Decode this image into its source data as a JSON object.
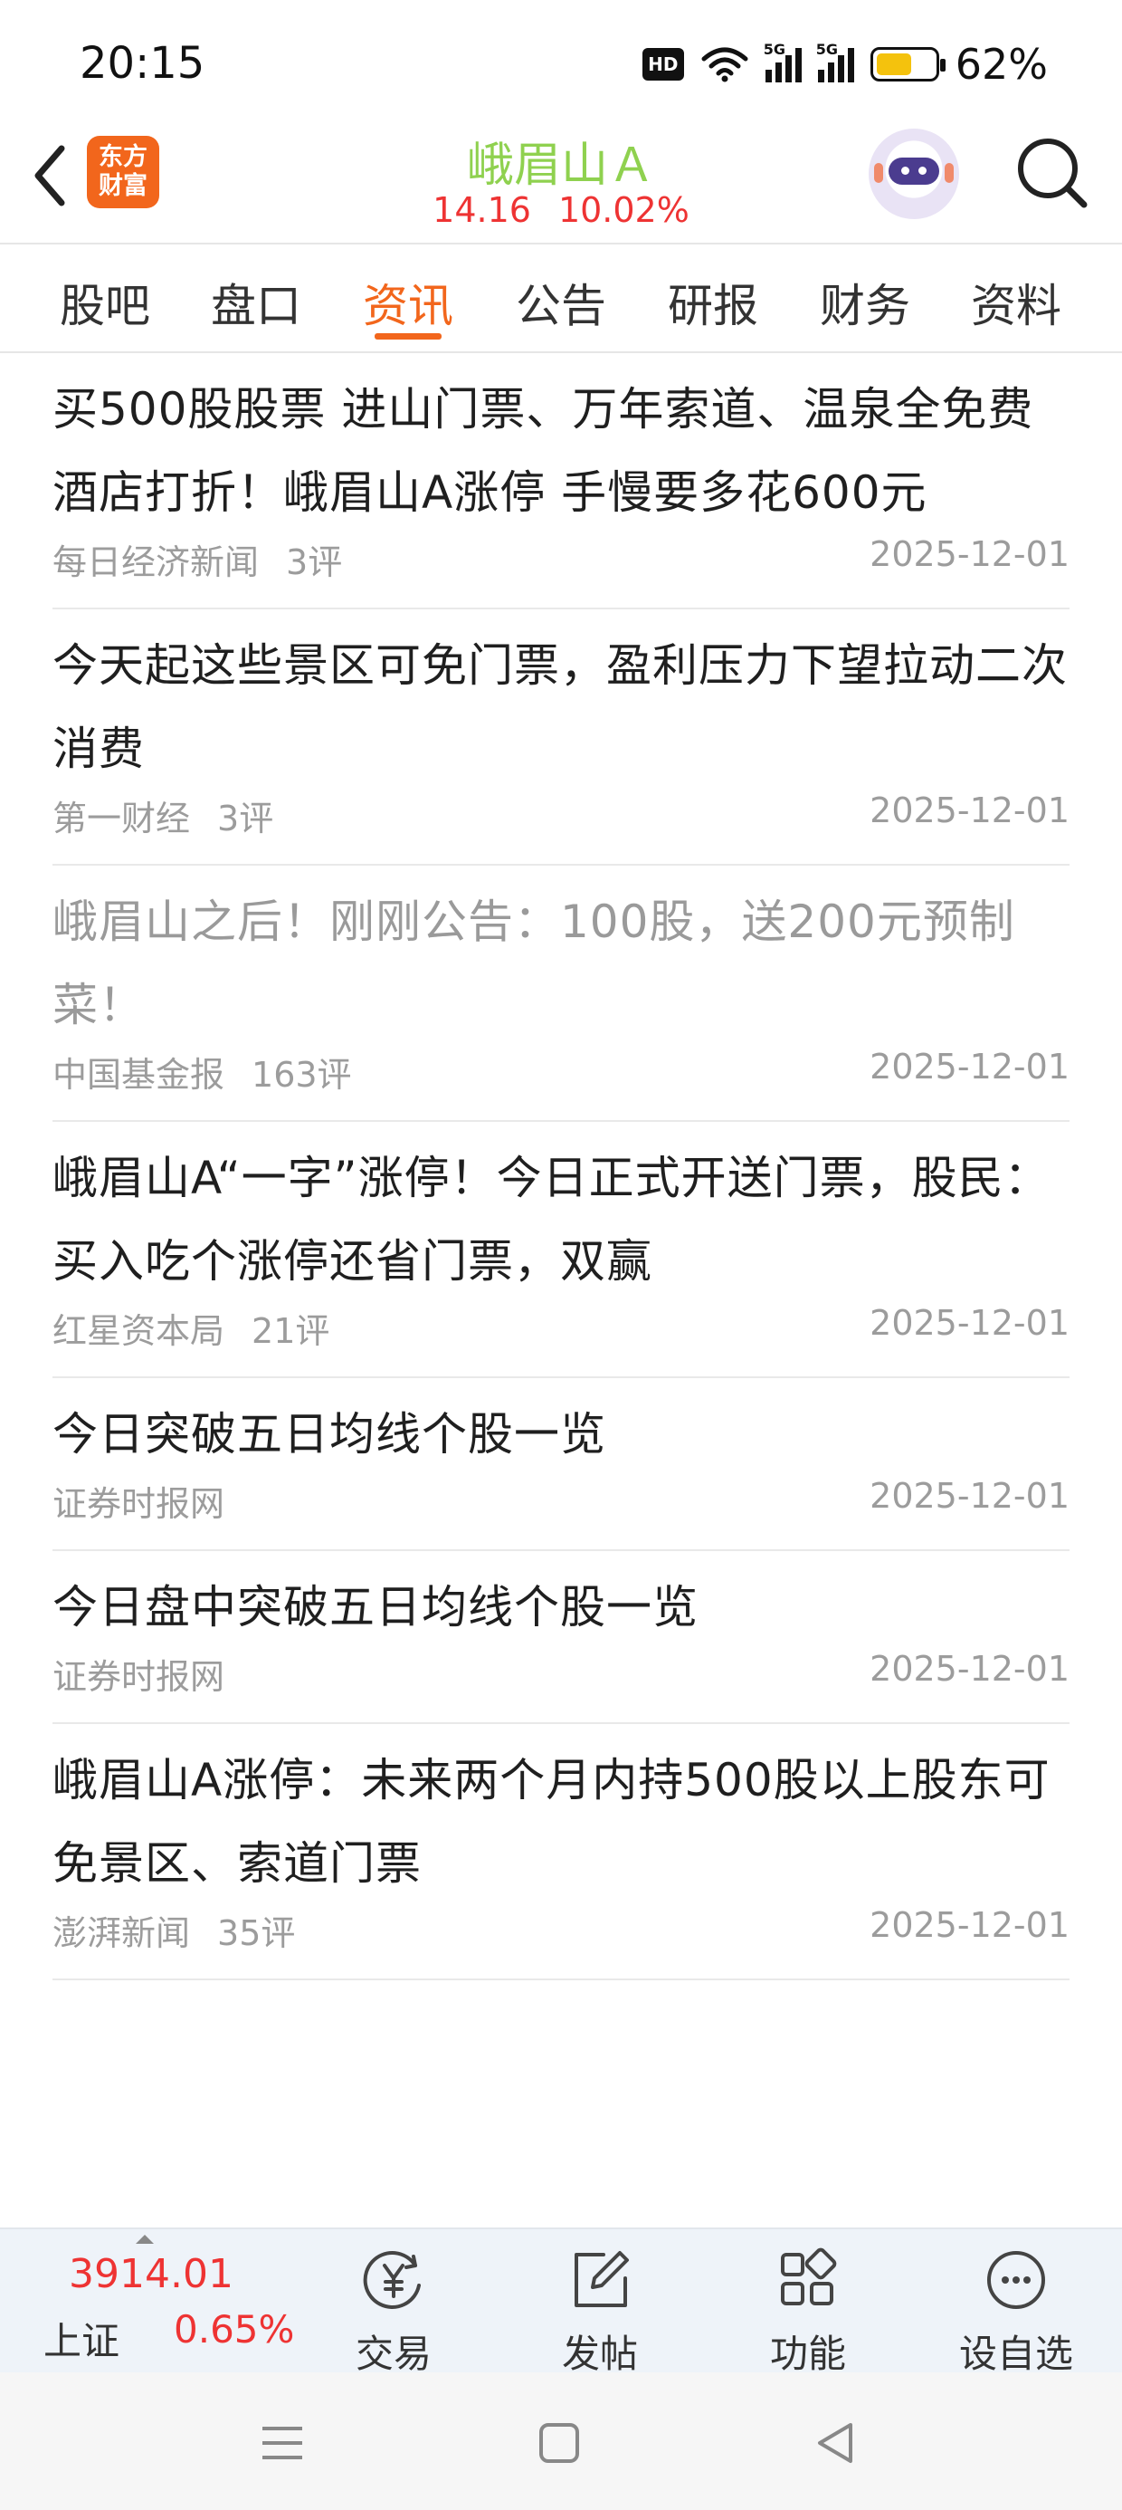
{
  "status_bar": {
    "time": "20:15",
    "hd_label": "HD",
    "network_label_1": "5G",
    "network_label_2": "5G",
    "battery_percent": "62%",
    "battery_level": 0.62
  },
  "header": {
    "app_logo_line1": "东方",
    "app_logo_line2": "财富",
    "stock_name": "峨眉山Ａ",
    "price": "14.16",
    "change_percent": "10.02%"
  },
  "tabs": [
    "股吧",
    "盘口",
    "资讯",
    "公告",
    "研报",
    "财务",
    "资料"
  ],
  "active_tab": "资讯",
  "news": [
    {
      "title": "买500股股票 进山门票、万年索道、温泉全免费 酒店打折！峨眉山A涨停 手慢要多花600元",
      "source": "每日经济新闻",
      "comments": "3评",
      "date": "2025-12-01",
      "read": false
    },
    {
      "title": "今天起这些景区可免门票，盈利压力下望拉动二次消费",
      "source": "第一财经",
      "comments": "3评",
      "date": "2025-12-01",
      "read": false
    },
    {
      "title": "峨眉山之后！刚刚公告：100股，送200元预制菜！",
      "source": "中国基金报",
      "comments": "163评",
      "date": "2025-12-01",
      "read": true
    },
    {
      "title": "峨眉山A“一字”涨停！今日正式开送门票，股民：买入吃个涨停还省门票，双赢",
      "source": "红星资本局",
      "comments": "21评",
      "date": "2025-12-01",
      "read": false
    },
    {
      "title": "今日突破五日均线个股一览",
      "source": "证券时报网",
      "comments": "",
      "date": "2025-12-01",
      "read": false
    },
    {
      "title": "今日盘中突破五日均线个股一览",
      "source": "证券时报网",
      "comments": "",
      "date": "2025-12-01",
      "read": false
    },
    {
      "title": "峨眉山A涨停：未来两个月内持500股以上股东可免景区、索道门票",
      "source": "澎湃新闻",
      "comments": "35评",
      "date": "2025-12-01",
      "read": false
    }
  ],
  "bottom_bar": {
    "index_value": "3914.01",
    "index_name": "上证",
    "index_change": "0.65%",
    "trade_label": "交易",
    "post_label": "发帖",
    "functions_label": "功能",
    "watchlist_label": "设自选"
  },
  "colors": {
    "accent": "#f2661c",
    "stock_name": "#8fd14f",
    "up": "#e33333",
    "meta_gray": "#9c9c9c"
  }
}
